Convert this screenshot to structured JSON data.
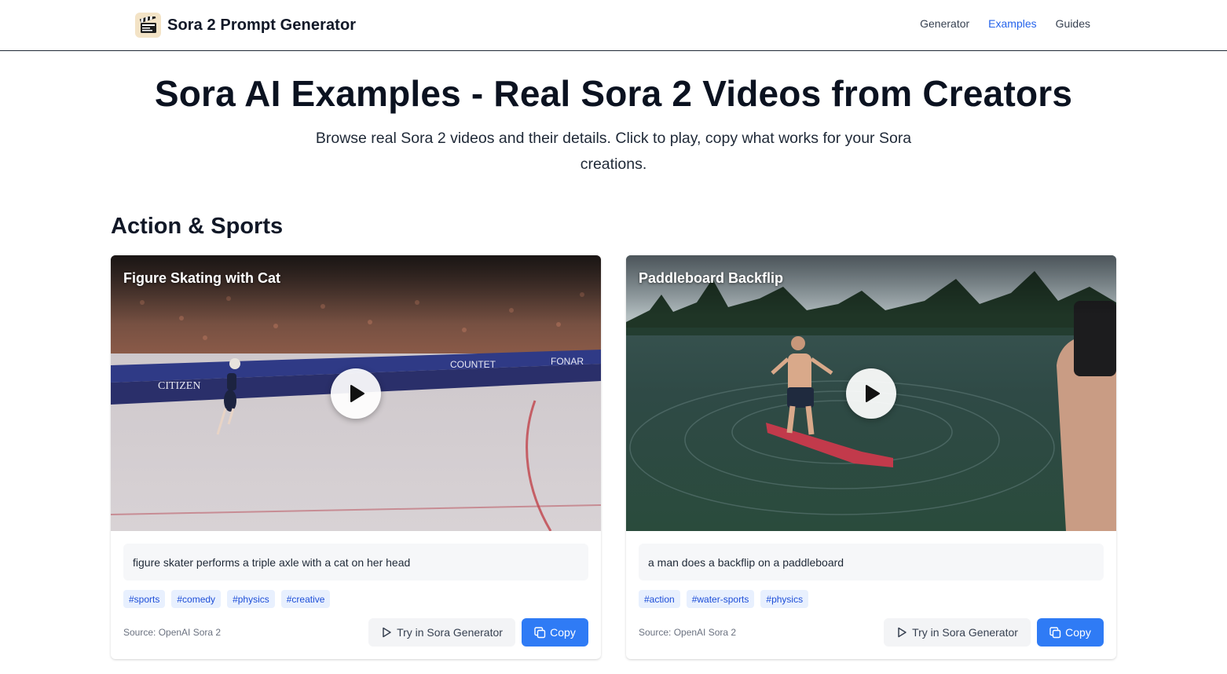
{
  "header": {
    "brand_title": "Sora 2 Prompt Generator",
    "logo_icon": "clapperboard-icon",
    "nav": [
      {
        "label": "Generator",
        "active": false
      },
      {
        "label": "Examples",
        "active": true
      },
      {
        "label": "Guides",
        "active": false
      }
    ]
  },
  "hero": {
    "title": "Sora AI Examples - Real Sora 2 Videos from Creators",
    "subtitle": "Browse real Sora 2 videos and their details. Click to play, copy what works for your Sora creations."
  },
  "section": {
    "title": "Action & Sports"
  },
  "cards": [
    {
      "title": "Figure Skating with Cat",
      "prompt": "figure skater performs a triple axle with a cat on her head",
      "tags": [
        "#sports",
        "#comedy",
        "#physics",
        "#creative"
      ],
      "source": "Source: OpenAI Sora 2",
      "try_label": "Try in Sora Generator",
      "copy_label": "Copy"
    },
    {
      "title": "Paddleboard Backflip",
      "prompt": "a man does a backflip on a paddleboard",
      "tags": [
        "#action",
        "#water-sports",
        "#physics"
      ],
      "source": "Source: OpenAI Sora 2",
      "try_label": "Try in Sora Generator",
      "copy_label": "Copy"
    }
  ],
  "colors": {
    "accent": "#2f7bf5",
    "nav_active": "#2563eb",
    "tag_bg": "#e8f0fe",
    "tag_text": "#1d4ed8"
  }
}
